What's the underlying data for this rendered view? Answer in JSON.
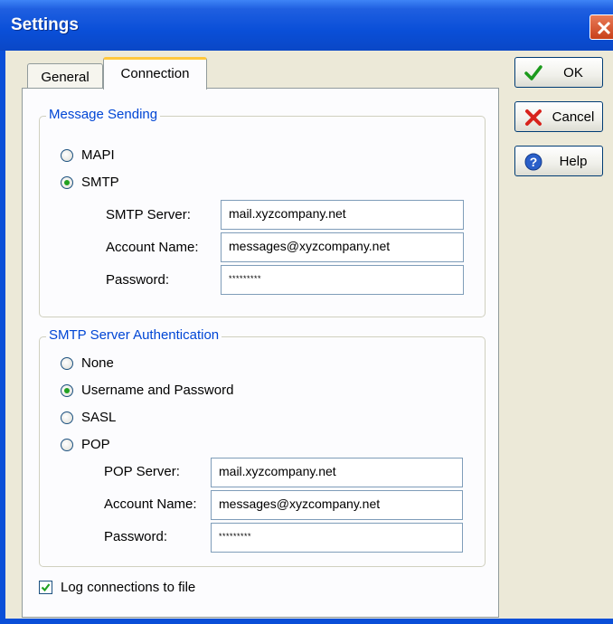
{
  "window": {
    "title": "Settings"
  },
  "tabs": [
    {
      "label": "General",
      "selected": false
    },
    {
      "label": "Connection",
      "selected": true
    }
  ],
  "message_sending": {
    "title": "Message Sending",
    "options": [
      {
        "label": "MAPI",
        "selected": false
      },
      {
        "label": "SMTP",
        "selected": true
      }
    ],
    "fields": {
      "smtp_server": {
        "label": "SMTP Server:",
        "value": "mail.xyzcompany.net"
      },
      "account_name": {
        "label": "Account Name:",
        "value": "messages@xyzcompany.net"
      },
      "password": {
        "label": "Password:",
        "value": "*********"
      }
    }
  },
  "smtp_auth": {
    "title": "SMTP Server Authentication",
    "options": [
      {
        "label": "None",
        "selected": false
      },
      {
        "label": "Username and Password",
        "selected": true
      },
      {
        "label": "SASL",
        "selected": false
      },
      {
        "label": "POP",
        "selected": false
      }
    ],
    "fields": {
      "pop_server": {
        "label": "POP Server:",
        "value": "mail.xyzcompany.net"
      },
      "account_name": {
        "label": "Account Name:",
        "value": "messages@xyzcompany.net"
      },
      "password": {
        "label": "Password:",
        "value": "*********"
      }
    }
  },
  "log_connections": {
    "label": "Log connections to file",
    "checked": true
  },
  "buttons": {
    "ok": {
      "label": "OK",
      "icon": "checkmark-icon"
    },
    "cancel": {
      "label": "Cancel",
      "icon": "red-x-icon"
    },
    "help": {
      "label": "Help",
      "icon": "help-icon"
    }
  },
  "colors": {
    "titlebar": "#0a4fd8",
    "group_title": "#0046d5",
    "dialog_bg": "#ece9d8",
    "tab_highlight": "#ffc83c"
  }
}
